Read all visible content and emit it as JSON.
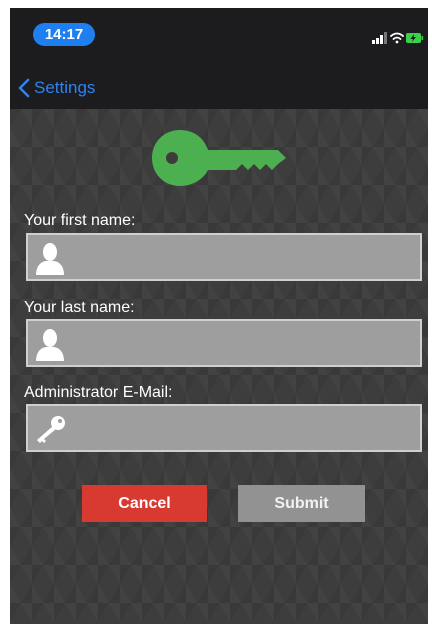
{
  "status_bar": {
    "time": "14:17",
    "icons": [
      "cellular-signal-icon",
      "wifi-icon",
      "battery-charging-icon"
    ]
  },
  "nav": {
    "back_label": "Settings",
    "back_icon": "chevron-left-icon"
  },
  "logo": {
    "icon": "key-icon",
    "color": "#4caf50"
  },
  "form": {
    "first_name": {
      "label": "Your first name:",
      "value": "",
      "icon": "user-icon"
    },
    "last_name": {
      "label": "Your last name:",
      "value": "",
      "icon": "user-icon"
    },
    "email": {
      "label": "Administrator E-Mail:",
      "value": "",
      "icon": "key-icon"
    }
  },
  "buttons": {
    "cancel": "Cancel",
    "submit": "Submit"
  },
  "colors": {
    "accent": "#1e7ff0",
    "cancel": "#d83a32",
    "submit": "#929292",
    "field": "#9e9e9e"
  }
}
